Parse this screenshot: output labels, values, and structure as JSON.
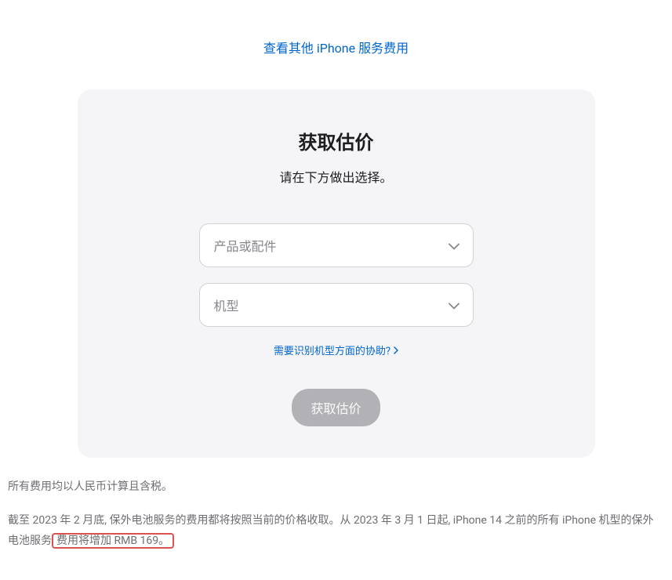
{
  "topLink": {
    "text": "查看其他 iPhone 服务费用"
  },
  "card": {
    "title": "获取估价",
    "subtitle": "请在下方做出选择。",
    "productSelect": {
      "placeholder": "产品或配件"
    },
    "modelSelect": {
      "placeholder": "机型"
    },
    "helpLink": {
      "text": "需要识别机型方面的协助?"
    },
    "submitButton": {
      "label": "获取估价"
    }
  },
  "footnotes": {
    "line1": "所有费用均以人民币计算且含税。",
    "line2_part1": "截至 2023 年 2 月底, 保外电池服务的费用都将按照当前的价格收取。从 2023 年 3 月 1 日起, iPhone 14 之前的所有 iPhone 机型的保外电池服务",
    "line2_highlight": "费用将增加 RMB 169。"
  }
}
